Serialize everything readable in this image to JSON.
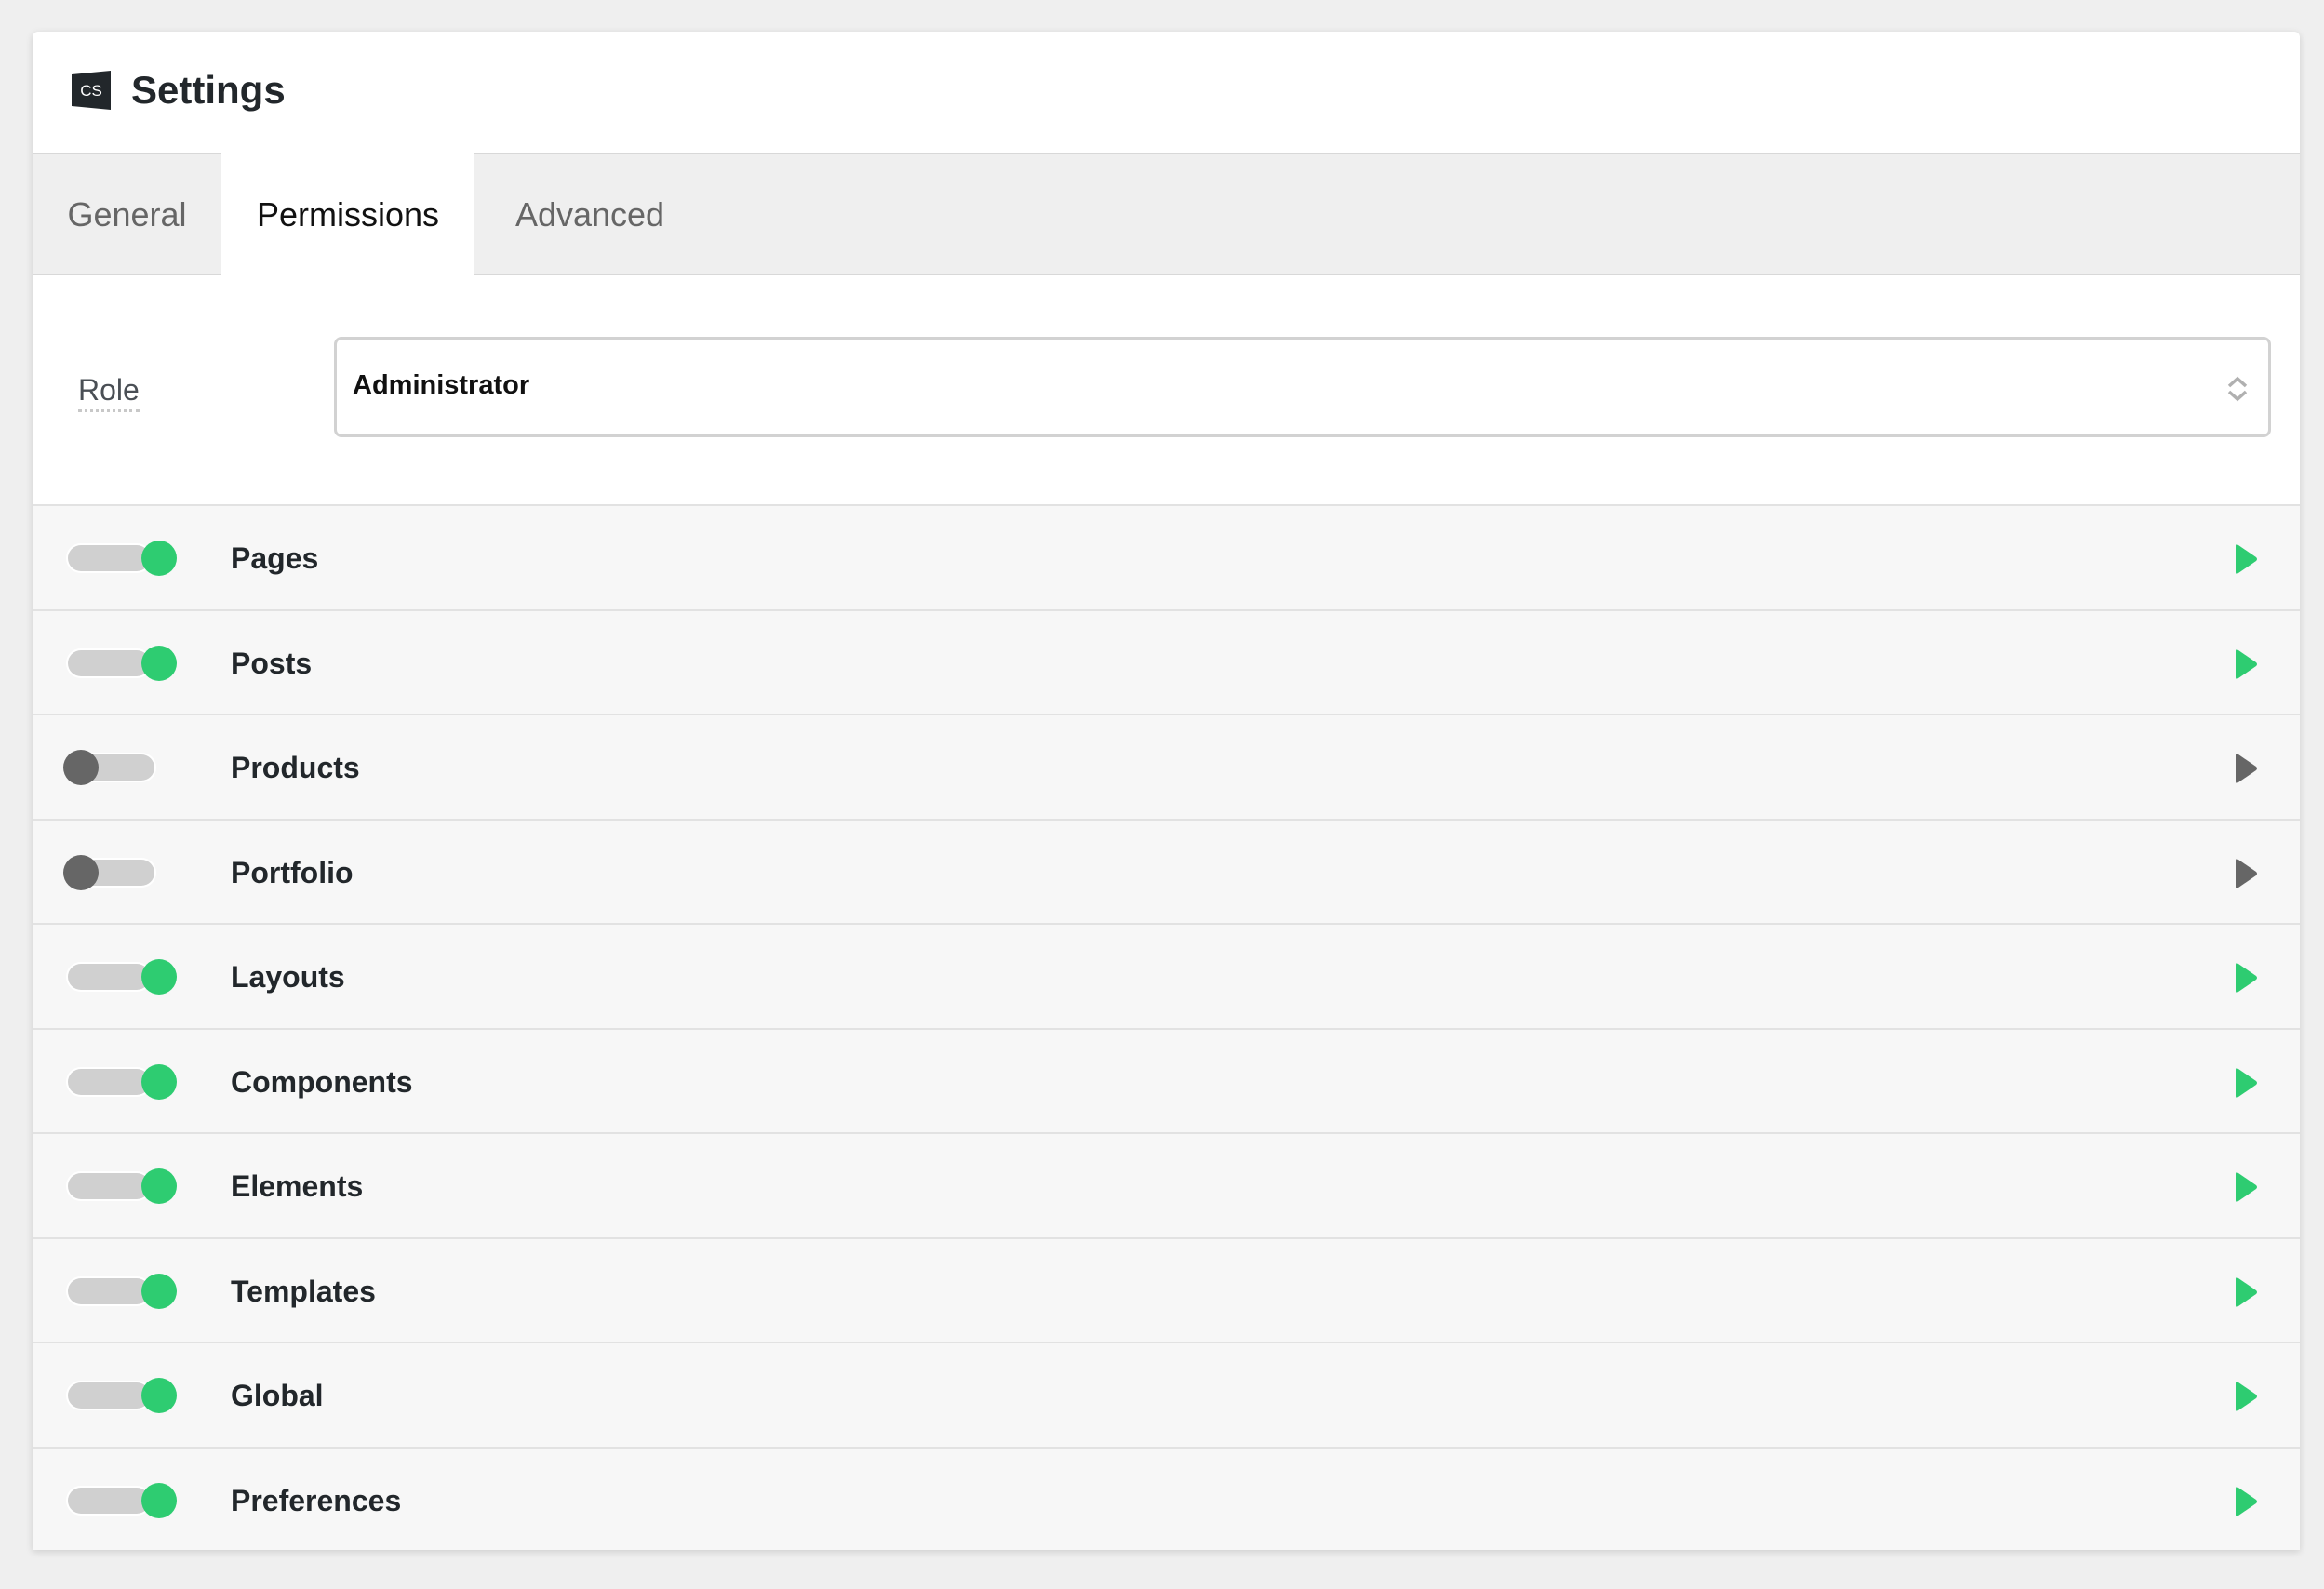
{
  "header": {
    "logo_text": "CS",
    "title": "Settings"
  },
  "tabs": [
    {
      "label": "General",
      "active": false
    },
    {
      "label": "Permissions",
      "active": true
    },
    {
      "label": "Advanced",
      "active": false
    }
  ],
  "role": {
    "label": "Role",
    "selected": "Administrator"
  },
  "colors": {
    "on": "#2ecc71",
    "off": "#666666",
    "track": "#d0d0d0"
  },
  "permissions": [
    {
      "label": "Pages",
      "enabled": true
    },
    {
      "label": "Posts",
      "enabled": true
    },
    {
      "label": "Products",
      "enabled": false
    },
    {
      "label": "Portfolio",
      "enabled": false
    },
    {
      "label": "Layouts",
      "enabled": true
    },
    {
      "label": "Components",
      "enabled": true
    },
    {
      "label": "Elements",
      "enabled": true
    },
    {
      "label": "Templates",
      "enabled": true
    },
    {
      "label": "Global",
      "enabled": true
    },
    {
      "label": "Preferences",
      "enabled": true
    }
  ]
}
